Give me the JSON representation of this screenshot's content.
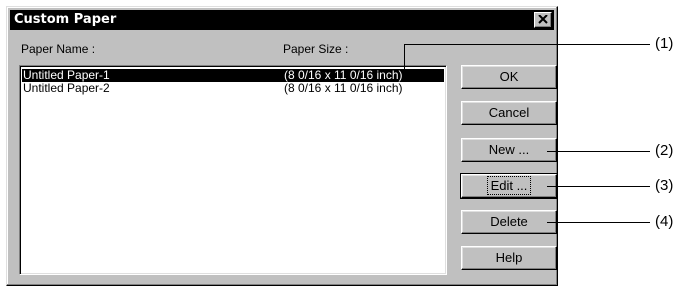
{
  "dialog": {
    "title": "Custom Paper",
    "close_glyph": "✕"
  },
  "list": {
    "header_name": "Paper Name :",
    "header_size": "Paper Size :",
    "rows": [
      {
        "name": "Untitled Paper-1",
        "size": "(8 0/16 x 11 0/16 inch)",
        "selected": true
      },
      {
        "name": "Untitled Paper-2",
        "size": "(8 0/16 x 11 0/16 inch)",
        "selected": false
      }
    ]
  },
  "buttons": {
    "ok": "OK",
    "cancel": "Cancel",
    "new": "New ...",
    "edit": "Edit ...",
    "delete": "Delete",
    "help": "Help"
  },
  "callouts": [
    "(1)",
    "(2)",
    "(3)",
    "(4)"
  ]
}
